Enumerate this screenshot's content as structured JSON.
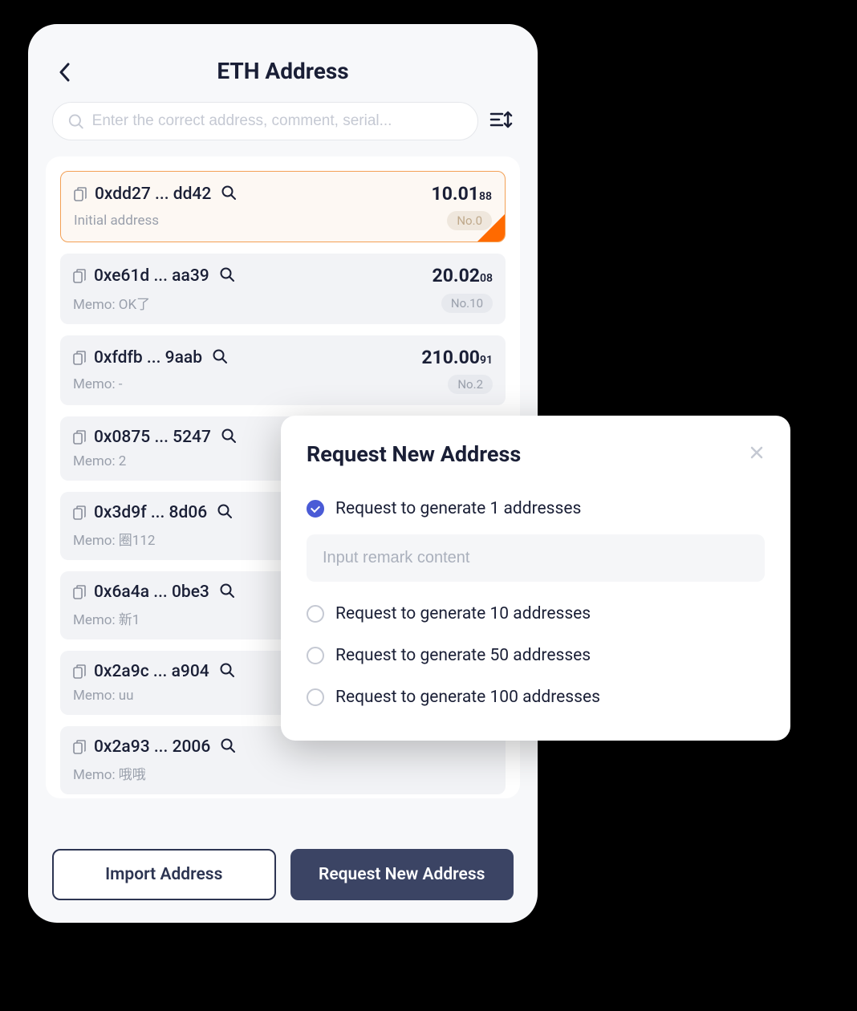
{
  "header": {
    "title": "ETH Address"
  },
  "search": {
    "placeholder": "Enter the correct address, comment, serial..."
  },
  "addresses": [
    {
      "addr": "0xdd27 ... dd42",
      "balance": "10.01",
      "balance_small": "88",
      "memo": "Initial address",
      "no": "No.0",
      "selected": true
    },
    {
      "addr": "0xe61d ... aa39",
      "balance": "20.02",
      "balance_small": "08",
      "memo": "Memo: OK了",
      "no": "No.10",
      "selected": false
    },
    {
      "addr": "0xfdfb ... 9aab",
      "balance": "210.00",
      "balance_small": "91",
      "memo": "Memo: -",
      "no": "No.2",
      "selected": false
    },
    {
      "addr": "0x0875 ... 5247",
      "balance": "",
      "balance_small": "",
      "memo": "Memo: 2",
      "no": "",
      "selected": false
    },
    {
      "addr": "0x3d9f ... 8d06",
      "balance": "",
      "balance_small": "",
      "memo": "Memo: 圈112",
      "no": "",
      "selected": false
    },
    {
      "addr": "0x6a4a ... 0be3",
      "balance": "",
      "balance_small": "",
      "memo": "Memo: 新1",
      "no": "",
      "selected": false
    },
    {
      "addr": "0x2a9c ... a904",
      "balance": "",
      "balance_small": "",
      "memo": "Memo: uu",
      "no": "",
      "selected": false
    },
    {
      "addr": "0x2a93 ... 2006",
      "balance": "",
      "balance_small": "",
      "memo": "Memo: 哦哦",
      "no": "",
      "selected": false
    }
  ],
  "buttons": {
    "import": "Import Address",
    "request": "Request New Address"
  },
  "modal": {
    "title": "Request New Address",
    "remark_placeholder": "Input remark content",
    "options": [
      {
        "label": "Request to generate 1 addresses",
        "checked": true,
        "has_input": true
      },
      {
        "label": "Request to generate 10 addresses",
        "checked": false,
        "has_input": false
      },
      {
        "label": "Request to generate 50 addresses",
        "checked": false,
        "has_input": false
      },
      {
        "label": "Request to generate 100 addresses",
        "checked": false,
        "has_input": false
      }
    ]
  }
}
